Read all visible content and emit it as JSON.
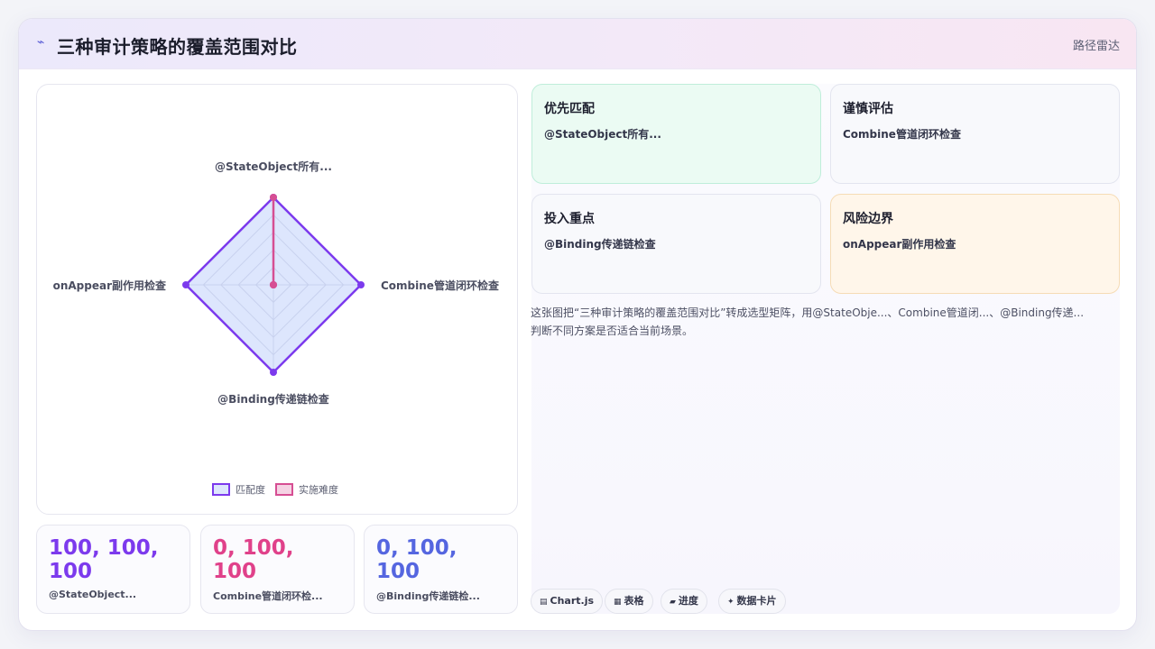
{
  "header": {
    "icon": "sparkle-icon",
    "title": "三种审计策略的覆盖范围对比",
    "tag": "路径雷达"
  },
  "chart_data": {
    "type": "radar",
    "axes": [
      "@StateObject所有...",
      "Combine管道闭环检查",
      "@Binding传递链检查",
      "onAppear副作用检查"
    ],
    "range": [
      0,
      100
    ],
    "grid": true,
    "legend_position": "bottom",
    "series": [
      {
        "name": "匹配度",
        "values": [
          100,
          100,
          100,
          100
        ],
        "color": "#7c3aed",
        "fill": "rgba(99,140,245,0.22)"
      },
      {
        "name": "实施难度",
        "values": [
          100,
          0,
          0,
          0
        ],
        "color": "#d64e93",
        "fill": "rgba(214,78,147,0.25)"
      }
    ]
  },
  "stats": [
    {
      "value": "100, 100, 100",
      "label": "@StateObject...",
      "color": "#7c3aed"
    },
    {
      "value": "0, 100, 100",
      "label": "Combine管道闭环检...",
      "color": "#e0418a"
    },
    {
      "value": "0, 100, 100",
      "label": "@Binding传递链检...",
      "color": "#5566e0"
    }
  ],
  "quadrants": [
    {
      "title": "优先匹配",
      "item": "@StateObject所有...",
      "bg": "#ebfbf3",
      "border": "#bfeeda"
    },
    {
      "title": "谨慎评估",
      "item": "Combine管道闭环检查",
      "bg": "#f8f9fc",
      "border": "#e3e5ef"
    },
    {
      "title": "投入重点",
      "item": "@Binding传递链检查",
      "bg": "#f8f9fc",
      "border": "#e3e5ef"
    },
    {
      "title": "风险边界",
      "item": "onAppear副作用检查",
      "bg": "#fff6ea",
      "border": "#f6dcb6"
    }
  ],
  "description": {
    "line1": "这张图把“三种审计策略的覆盖范围对比”转成选型矩阵，用@StateObje...、Combine管道闭...、@Binding传递...",
    "line2": "判断不同方案是否适合当前场景。"
  },
  "chips": [
    {
      "icon": "chart-icon",
      "glyph": "▤",
      "label": "Chart.js"
    },
    {
      "icon": "table-icon",
      "glyph": "▦",
      "label": "表格"
    },
    {
      "icon": "progress-icon",
      "glyph": "▰",
      "label": "进度"
    },
    {
      "icon": "card-icon",
      "glyph": "✦",
      "label": "数据卡片"
    }
  ]
}
